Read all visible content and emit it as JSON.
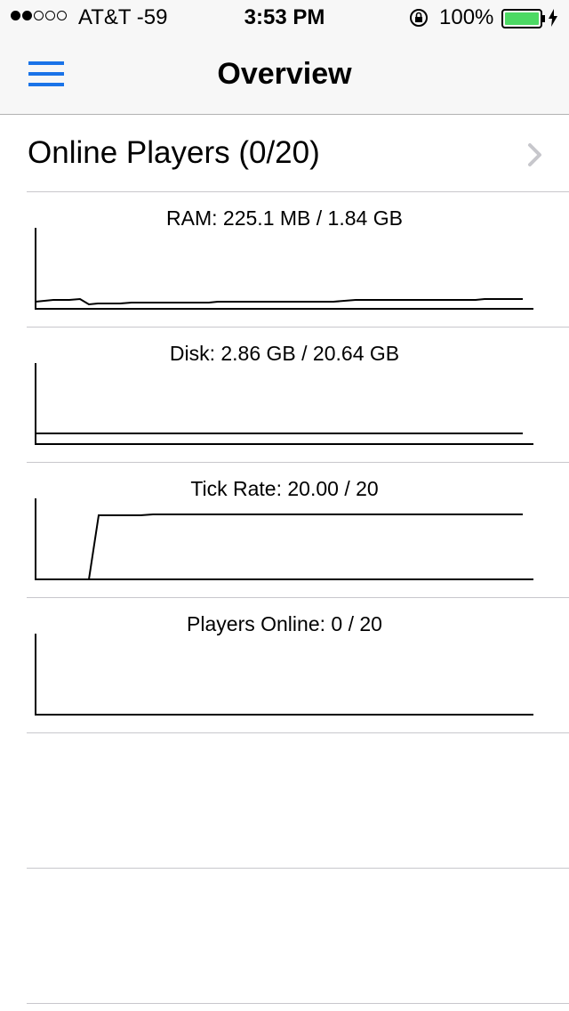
{
  "status_bar": {
    "signal_bars_filled": 2,
    "signal_bars_total": 5,
    "carrier": "AT&T  -59",
    "time": "3:53 PM",
    "battery": "100%",
    "icons": [
      "rotation-lock-icon",
      "battery-icon",
      "charging-icon"
    ]
  },
  "nav": {
    "title": "Overview",
    "menu_icon": "hamburger-menu-icon"
  },
  "online_players_row": {
    "label": "Online Players (0/20)",
    "icon": "chevron-right-icon"
  },
  "colors": {
    "accent": "#1a73e8",
    "battery_fill": "#4cd964",
    "separator": "#c8c7cc"
  },
  "graphs": [
    {
      "title": "RAM: 225.1 MB / 1.84 GB"
    },
    {
      "title": "Disk: 2.86 GB / 20.64 GB"
    },
    {
      "title": "Tick Rate: 20.00 / 20"
    },
    {
      "title": "Players Online: 0 / 20"
    }
  ]
}
